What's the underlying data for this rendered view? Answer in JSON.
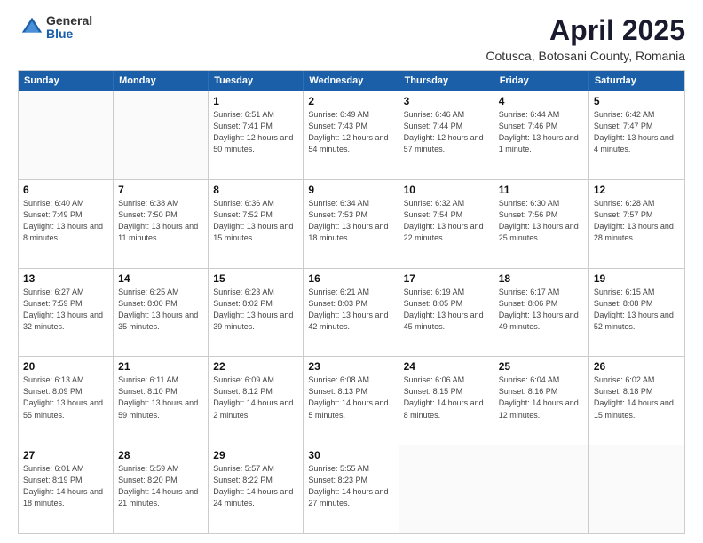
{
  "logo": {
    "general": "General",
    "blue": "Blue"
  },
  "title": "April 2025",
  "subtitle": "Cotusca, Botosani County, Romania",
  "days_of_week": [
    "Sunday",
    "Monday",
    "Tuesday",
    "Wednesday",
    "Thursday",
    "Friday",
    "Saturday"
  ],
  "weeks": [
    [
      {
        "day": "",
        "info": ""
      },
      {
        "day": "",
        "info": ""
      },
      {
        "day": "1",
        "info": "Sunrise: 6:51 AM\nSunset: 7:41 PM\nDaylight: 12 hours\nand 50 minutes."
      },
      {
        "day": "2",
        "info": "Sunrise: 6:49 AM\nSunset: 7:43 PM\nDaylight: 12 hours\nand 54 minutes."
      },
      {
        "day": "3",
        "info": "Sunrise: 6:46 AM\nSunset: 7:44 PM\nDaylight: 12 hours\nand 57 minutes."
      },
      {
        "day": "4",
        "info": "Sunrise: 6:44 AM\nSunset: 7:46 PM\nDaylight: 13 hours\nand 1 minute."
      },
      {
        "day": "5",
        "info": "Sunrise: 6:42 AM\nSunset: 7:47 PM\nDaylight: 13 hours\nand 4 minutes."
      }
    ],
    [
      {
        "day": "6",
        "info": "Sunrise: 6:40 AM\nSunset: 7:49 PM\nDaylight: 13 hours\nand 8 minutes."
      },
      {
        "day": "7",
        "info": "Sunrise: 6:38 AM\nSunset: 7:50 PM\nDaylight: 13 hours\nand 11 minutes."
      },
      {
        "day": "8",
        "info": "Sunrise: 6:36 AM\nSunset: 7:52 PM\nDaylight: 13 hours\nand 15 minutes."
      },
      {
        "day": "9",
        "info": "Sunrise: 6:34 AM\nSunset: 7:53 PM\nDaylight: 13 hours\nand 18 minutes."
      },
      {
        "day": "10",
        "info": "Sunrise: 6:32 AM\nSunset: 7:54 PM\nDaylight: 13 hours\nand 22 minutes."
      },
      {
        "day": "11",
        "info": "Sunrise: 6:30 AM\nSunset: 7:56 PM\nDaylight: 13 hours\nand 25 minutes."
      },
      {
        "day": "12",
        "info": "Sunrise: 6:28 AM\nSunset: 7:57 PM\nDaylight: 13 hours\nand 28 minutes."
      }
    ],
    [
      {
        "day": "13",
        "info": "Sunrise: 6:27 AM\nSunset: 7:59 PM\nDaylight: 13 hours\nand 32 minutes."
      },
      {
        "day": "14",
        "info": "Sunrise: 6:25 AM\nSunset: 8:00 PM\nDaylight: 13 hours\nand 35 minutes."
      },
      {
        "day": "15",
        "info": "Sunrise: 6:23 AM\nSunset: 8:02 PM\nDaylight: 13 hours\nand 39 minutes."
      },
      {
        "day": "16",
        "info": "Sunrise: 6:21 AM\nSunset: 8:03 PM\nDaylight: 13 hours\nand 42 minutes."
      },
      {
        "day": "17",
        "info": "Sunrise: 6:19 AM\nSunset: 8:05 PM\nDaylight: 13 hours\nand 45 minutes."
      },
      {
        "day": "18",
        "info": "Sunrise: 6:17 AM\nSunset: 8:06 PM\nDaylight: 13 hours\nand 49 minutes."
      },
      {
        "day": "19",
        "info": "Sunrise: 6:15 AM\nSunset: 8:08 PM\nDaylight: 13 hours\nand 52 minutes."
      }
    ],
    [
      {
        "day": "20",
        "info": "Sunrise: 6:13 AM\nSunset: 8:09 PM\nDaylight: 13 hours\nand 55 minutes."
      },
      {
        "day": "21",
        "info": "Sunrise: 6:11 AM\nSunset: 8:10 PM\nDaylight: 13 hours\nand 59 minutes."
      },
      {
        "day": "22",
        "info": "Sunrise: 6:09 AM\nSunset: 8:12 PM\nDaylight: 14 hours\nand 2 minutes."
      },
      {
        "day": "23",
        "info": "Sunrise: 6:08 AM\nSunset: 8:13 PM\nDaylight: 14 hours\nand 5 minutes."
      },
      {
        "day": "24",
        "info": "Sunrise: 6:06 AM\nSunset: 8:15 PM\nDaylight: 14 hours\nand 8 minutes."
      },
      {
        "day": "25",
        "info": "Sunrise: 6:04 AM\nSunset: 8:16 PM\nDaylight: 14 hours\nand 12 minutes."
      },
      {
        "day": "26",
        "info": "Sunrise: 6:02 AM\nSunset: 8:18 PM\nDaylight: 14 hours\nand 15 minutes."
      }
    ],
    [
      {
        "day": "27",
        "info": "Sunrise: 6:01 AM\nSunset: 8:19 PM\nDaylight: 14 hours\nand 18 minutes."
      },
      {
        "day": "28",
        "info": "Sunrise: 5:59 AM\nSunset: 8:20 PM\nDaylight: 14 hours\nand 21 minutes."
      },
      {
        "day": "29",
        "info": "Sunrise: 5:57 AM\nSunset: 8:22 PM\nDaylight: 14 hours\nand 24 minutes."
      },
      {
        "day": "30",
        "info": "Sunrise: 5:55 AM\nSunset: 8:23 PM\nDaylight: 14 hours\nand 27 minutes."
      },
      {
        "day": "",
        "info": ""
      },
      {
        "day": "",
        "info": ""
      },
      {
        "day": "",
        "info": ""
      }
    ]
  ]
}
